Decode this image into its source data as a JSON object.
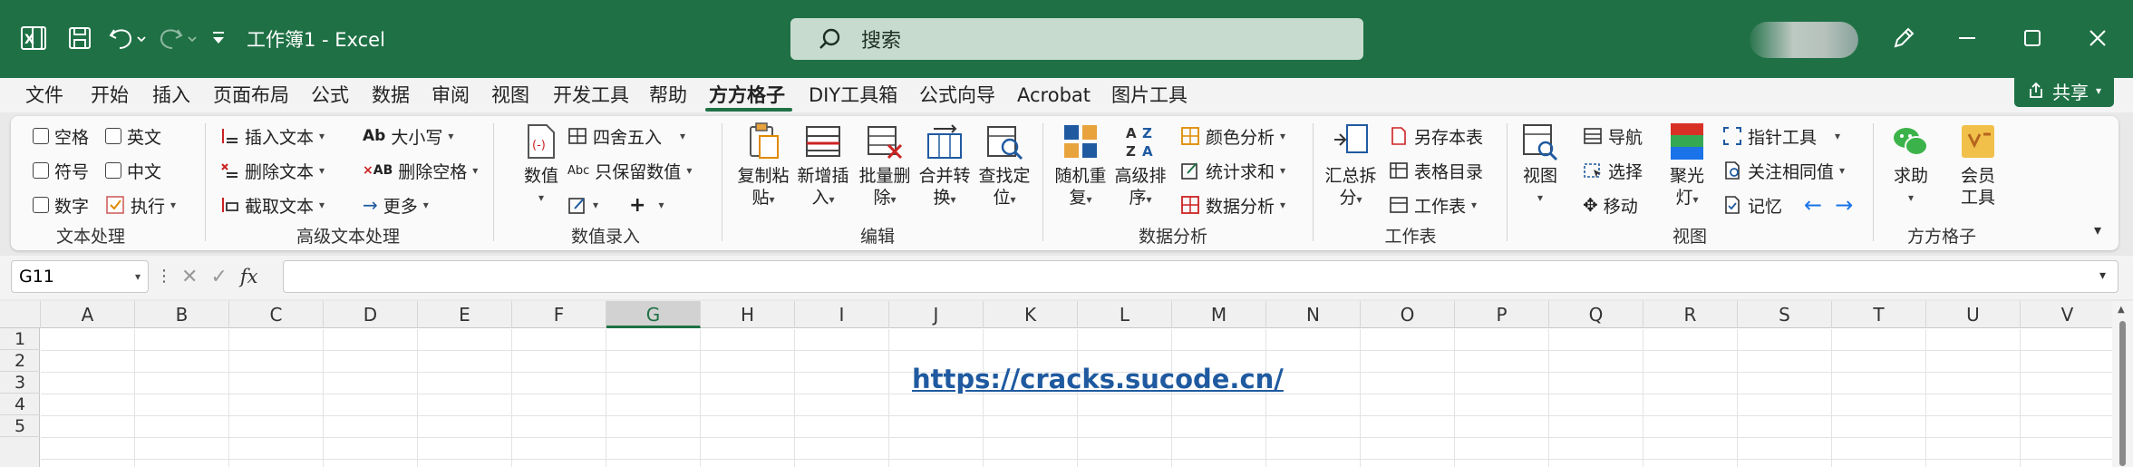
{
  "app": {
    "title": "工作簿1  -  Excel",
    "search_placeholder": "搜索",
    "share_label": "共享",
    "accent_color": "#1f7145"
  },
  "menu": {
    "tabs": [
      "文件",
      "开始",
      "插入",
      "页面布局",
      "公式",
      "数据",
      "审阅",
      "视图",
      "开发工具",
      "帮助",
      "方方格子",
      "DIY工具箱",
      "公式向导",
      "Acrobat",
      "图片工具"
    ],
    "active_tab": "方方格子"
  },
  "ribbon": {
    "text_processing": {
      "label": "文本处理",
      "items": [
        "空格",
        "英文",
        "符号",
        "中文",
        "数字",
        "执行"
      ]
    },
    "advanced_text": {
      "label": "高级文本处理",
      "items": [
        "插入文本",
        "删除文本",
        "截取文本",
        "大小写",
        "删除空格",
        "更多"
      ]
    },
    "numeric_entry": {
      "label": "数值录入",
      "big": "数值",
      "items": [
        "四舍五入",
        "只保留数值"
      ]
    },
    "edit": {
      "label": "编辑",
      "buttons": [
        [
          "复制粘",
          "贴"
        ],
        [
          "新增插",
          "入"
        ],
        [
          "批量删",
          "除"
        ],
        [
          "合并转",
          "换"
        ],
        [
          "查找定",
          "位"
        ]
      ]
    },
    "data_analysis": {
      "label": "数据分析",
      "buttons": [
        [
          "随机重",
          "复"
        ],
        [
          "高级排",
          "序"
        ]
      ],
      "items": [
        "颜色分析",
        "统计求和",
        "数据分析"
      ]
    },
    "worksheet": {
      "label": "工作表",
      "big": [
        "汇总拆",
        "分"
      ],
      "items": [
        "另存本表",
        "表格目录",
        "工作表"
      ]
    },
    "view": {
      "label": "视图",
      "big1": "视图",
      "items": [
        "导航",
        "选择",
        "移动"
      ],
      "big2": [
        "聚光",
        "灯"
      ],
      "items2": [
        "指针工具",
        "关注相同值",
        "记忆"
      ]
    },
    "fangfang": {
      "label": "方方格子",
      "buttons": [
        [
          "求助"
        ],
        [
          "会员",
          "工具"
        ]
      ]
    }
  },
  "formula_bar": {
    "name_box": "G11",
    "formula": ""
  },
  "sheet": {
    "columns": [
      "A",
      "B",
      "C",
      "D",
      "E",
      "F",
      "G",
      "H",
      "I",
      "J",
      "K",
      "L",
      "M",
      "N",
      "O",
      "P",
      "Q",
      "R",
      "S",
      "T",
      "U",
      "V"
    ],
    "selected_column": "G",
    "rows": [
      "1",
      "2",
      "3",
      "4",
      "5"
    ],
    "link_text": "https://cracks.sucode.cn/"
  }
}
